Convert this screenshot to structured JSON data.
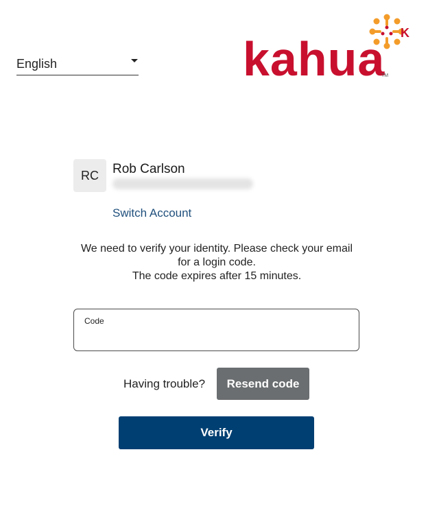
{
  "language_select": {
    "value": "English",
    "icon": "caret-down-icon"
  },
  "brand": {
    "wordmark": "kahua",
    "trademark": "TM",
    "emblem_letter": "K",
    "colors": {
      "wordmark": "#c8102e",
      "emblem": "#f39c2a"
    }
  },
  "account": {
    "initials": "RC",
    "name": "Rob Carlson",
    "switch_label": "Switch Account"
  },
  "message": {
    "line1": "We need to verify your identity. Please check your email",
    "line2": "for a login code.",
    "line3": "The code expires after 15 minutes."
  },
  "code_field": {
    "label": "Code",
    "value": ""
  },
  "trouble_text": "Having trouble?",
  "resend_label": "Resend code",
  "verify_label": "Verify",
  "colors": {
    "primary": "#003f72",
    "secondary_button": "#6b6e70",
    "link": "#1f4f7c"
  }
}
